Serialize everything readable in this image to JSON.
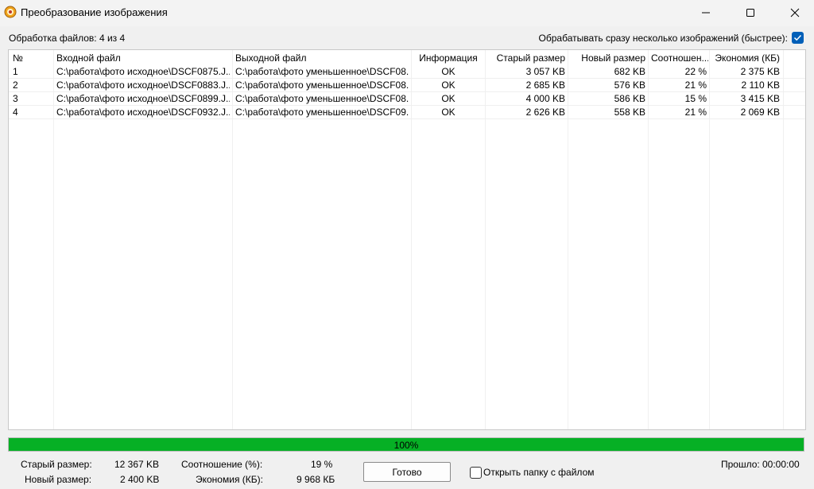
{
  "window": {
    "title": "Преобразование изображения"
  },
  "status_text": "Обработка файлов: 4 из 4",
  "multi_option": {
    "label": "Обрабатывать сразу несколько изображений (быстрее):",
    "checked": true
  },
  "table": {
    "headers": [
      "№",
      "Входной файл",
      "Выходной файл",
      "Информация",
      "Старый размер",
      "Новый размер",
      "Соотношен...",
      "Экономия (КБ)"
    ],
    "rows": [
      [
        "1",
        "C:\\работа\\фото исходное\\DSCF0875.J...",
        "C:\\работа\\фото уменьшенное\\DSCF08...",
        "OK",
        "3 057 KB",
        "682 KB",
        "22 %",
        "2 375 KB"
      ],
      [
        "2",
        "C:\\работа\\фото исходное\\DSCF0883.J...",
        "C:\\работа\\фото уменьшенное\\DSCF08...",
        "OK",
        "2 685 KB",
        "576 KB",
        "21 %",
        "2 110 KB"
      ],
      [
        "3",
        "C:\\работа\\фото исходное\\DSCF0899.J...",
        "C:\\работа\\фото уменьшенное\\DSCF08...",
        "OK",
        "4 000 KB",
        "586 KB",
        "15 %",
        "3 415 KB"
      ],
      [
        "4",
        "C:\\работа\\фото исходное\\DSCF0932.J...",
        "C:\\работа\\фото уменьшенное\\DSCF09...",
        "OK",
        "2 626 KB",
        "558 KB",
        "21 %",
        "2 069 KB"
      ]
    ]
  },
  "progress": {
    "percent": 100,
    "label": "100%",
    "color": "#06b025"
  },
  "summary": {
    "old_size_label": "Старый размер:",
    "old_size_value": "12 367 KB",
    "new_size_label": "Новый размер:",
    "new_size_value": "2 400 KB",
    "ratio_label": "Соотношение (%):",
    "ratio_value": "19 %",
    "savings_label": "Экономия (КБ):",
    "savings_value": "9 968 КБ"
  },
  "done_button": "Готово",
  "open_folder": {
    "label": "Открыть папку с файлом",
    "checked": false
  },
  "elapsed": {
    "label": "Прошло:",
    "value": "00:00:00"
  },
  "icons": {
    "app": "app-icon",
    "minimize": "minimize-icon",
    "maximize": "maximize-icon",
    "close": "close-icon",
    "check": "checkmark-icon"
  },
  "colors": {
    "accent": "#005fb8",
    "progress": "#06b025"
  }
}
